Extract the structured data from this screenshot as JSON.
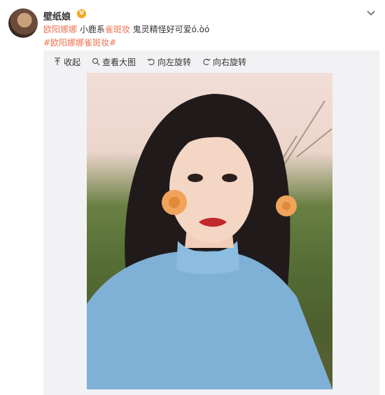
{
  "user": {
    "name": "壁纸娘",
    "badge": "V"
  },
  "post": {
    "mention": "欧阳娜娜",
    "text_a": " 小鹿系",
    "keyword": "雀斑妆",
    "text_b": " 鬼灵精怪好可爱ó.òó",
    "hashtag": "#欧阳娜娜雀斑妆#"
  },
  "toolbar": {
    "collapse": "收起",
    "view_large": "查看大图",
    "rotate_left": "向左旋转",
    "rotate_right": "向右旋转"
  },
  "icons": [
    "chevron-down-icon",
    "collapse-icon",
    "magnifier-icon",
    "rotate-left-icon",
    "rotate-right-icon"
  ],
  "colors": {
    "accent": "#eb7350",
    "badge": "#f5a623",
    "panel": "#f2f2f5"
  }
}
